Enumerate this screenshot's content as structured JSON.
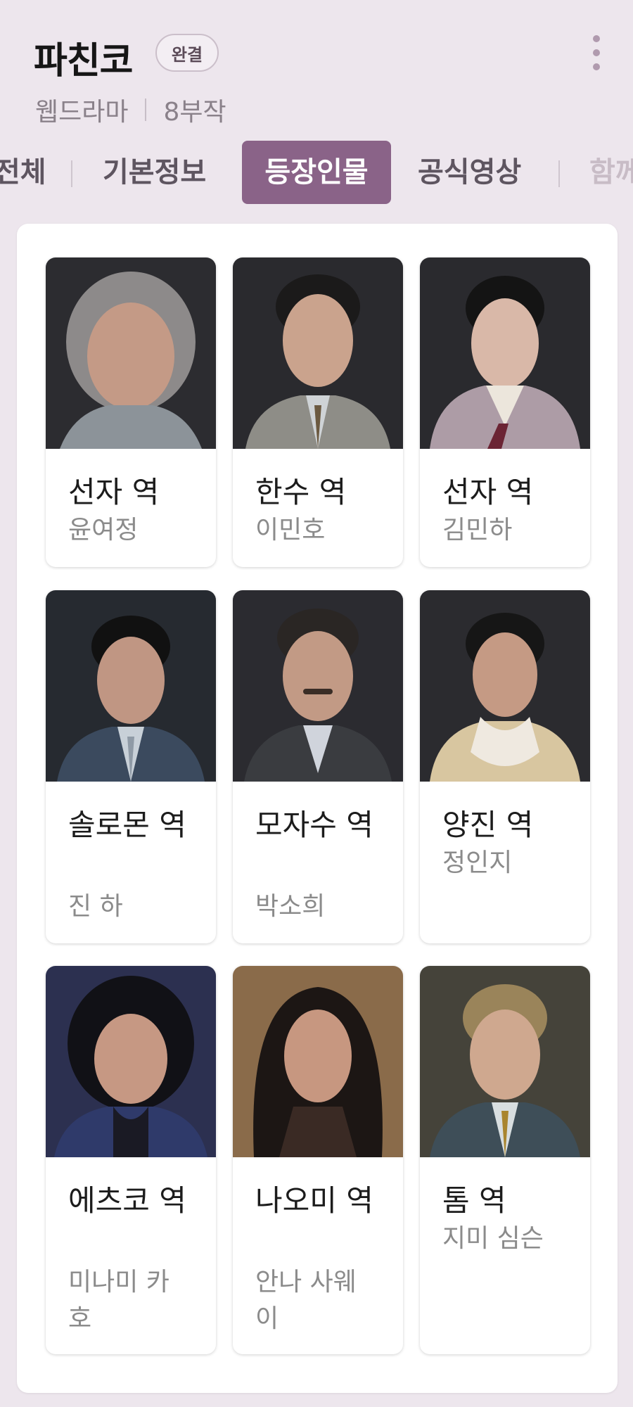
{
  "header": {
    "title": "파친코",
    "badge": "완결",
    "genre": "웹드라마",
    "episodes": "8부작"
  },
  "tabs": [
    {
      "label": "전체"
    },
    {
      "label": "기본정보"
    },
    {
      "label": "등장인물",
      "active": true
    },
    {
      "label": "공식영상"
    },
    {
      "label": "함께"
    }
  ],
  "cast": [
    {
      "role": "선자 역",
      "actor": "윤여정",
      "photo_icon": "portrait-elderly-woman"
    },
    {
      "role": "한수 역",
      "actor": "이민호",
      "photo_icon": "portrait-man-suit"
    },
    {
      "role": "선자 역",
      "actor": "김민하",
      "photo_icon": "portrait-young-woman-hanbok"
    },
    {
      "role": "솔로몬 역",
      "actor": "진 하",
      "photo_icon": "portrait-man-suit"
    },
    {
      "role": "모자수 역",
      "actor": "박소희",
      "photo_icon": "portrait-man-mustache"
    },
    {
      "role": "양진 역",
      "actor": "정인지",
      "photo_icon": "portrait-woman-scarf"
    },
    {
      "role": "에츠코 역",
      "actor": "미나미 카\n호",
      "photo_icon": "portrait-woman-curly-hair"
    },
    {
      "role": "나오미 역",
      "actor": "안나 사웨\n이",
      "photo_icon": "portrait-woman-long-hair"
    },
    {
      "role": "톰 역",
      "actor": "지미 심슨",
      "photo_icon": "portrait-man-blond"
    }
  ],
  "colors": {
    "accent": "#8a6388",
    "background": "#ede6ed"
  }
}
